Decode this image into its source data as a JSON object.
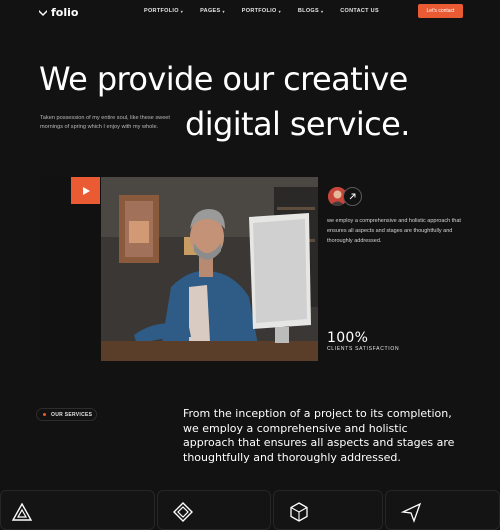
{
  "header": {
    "logo_text": "folio",
    "nav": [
      {
        "label": "PORTFOLIO",
        "has_dropdown": true
      },
      {
        "label": "PAGES",
        "has_dropdown": true
      },
      {
        "label": "PORTFOLIO",
        "has_dropdown": true
      },
      {
        "label": "BLOGS",
        "has_dropdown": true
      },
      {
        "label": "CONTACT US",
        "has_dropdown": false
      }
    ],
    "cta_label": "Let's contact"
  },
  "hero": {
    "title_line1": "We provide our creative",
    "title_line2": "digital service.",
    "subtitle": "Taken possession of my entire soul, like these sweet mornings of spring which I enjoy with my whole."
  },
  "media": {
    "play_icon": "play-icon",
    "arrow_icon": "arrow-up-right-icon",
    "description": "we employ a comprehensive and holistic approach that ensures all aspects and stages are thoughtfully and thoroughly addressed.",
    "stat_value": "100%",
    "stat_label": "CLIENTS SATISFACTION"
  },
  "services": {
    "pill_label": "OUR SERVICES",
    "description": "From the inception of a project to its completion, we employ a comprehensive and holistic approach that ensures all aspects and stages are thoughtfully and thoroughly addressed."
  },
  "colors": {
    "background": "#121213",
    "accent": "#ea5b34",
    "text": "#ffffff"
  }
}
